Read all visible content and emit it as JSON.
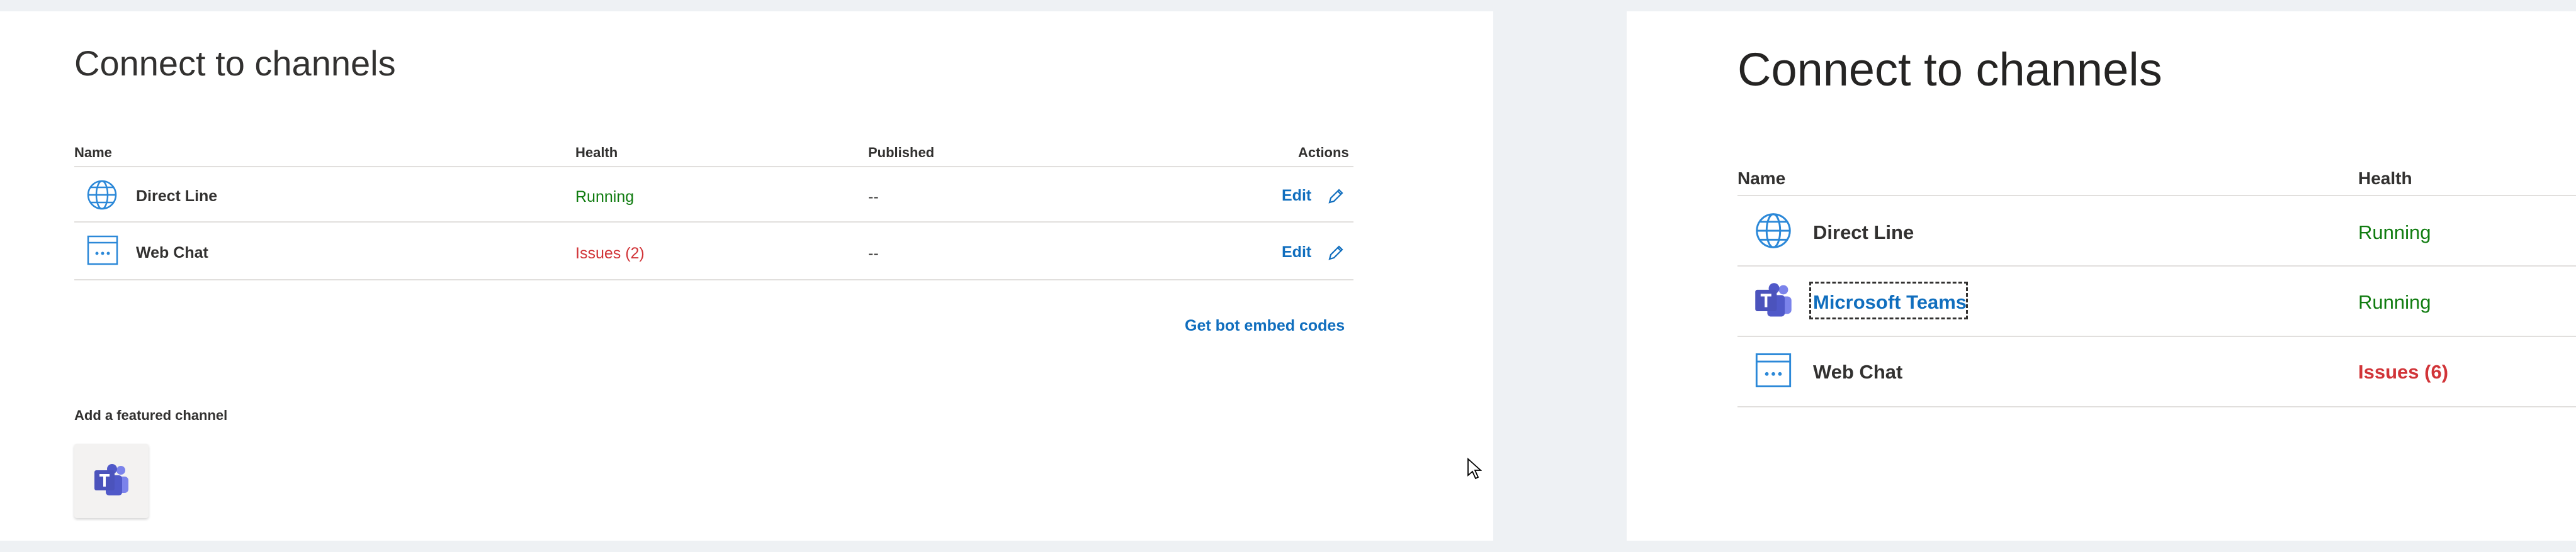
{
  "left": {
    "title": "Connect to channels",
    "columns": {
      "name": "Name",
      "health": "Health",
      "published": "Published",
      "actions": "Actions"
    },
    "rows": [
      {
        "name": "Direct Line",
        "health": "Running",
        "health_status": "ok",
        "published": "--",
        "action": "Edit",
        "icon": "globe-icon"
      },
      {
        "name": "Web Chat",
        "health": "Issues (2)",
        "health_status": "error",
        "published": "--",
        "action": "Edit",
        "icon": "webchat-icon"
      }
    ],
    "embed_link": "Get bot embed codes",
    "featured_heading": "Add a featured channel",
    "featured_icon": "microsoft-teams-icon"
  },
  "right": {
    "title": "Connect to channels",
    "columns": {
      "name": "Name",
      "health": "Health"
    },
    "rows": [
      {
        "name": "Direct Line",
        "health": "Running",
        "health_status": "ok",
        "icon": "globe-icon"
      },
      {
        "name": "Microsoft Teams",
        "health": "Running",
        "health_status": "ok",
        "icon": "microsoft-teams-icon",
        "focused": true
      },
      {
        "name": "Web Chat",
        "health": "Issues (6)",
        "health_status": "error",
        "icon": "webchat-icon"
      }
    ]
  },
  "colors": {
    "accent": "#106ebe",
    "running": "#107c10",
    "issues": "#d13438",
    "teams": "#5059c9"
  }
}
